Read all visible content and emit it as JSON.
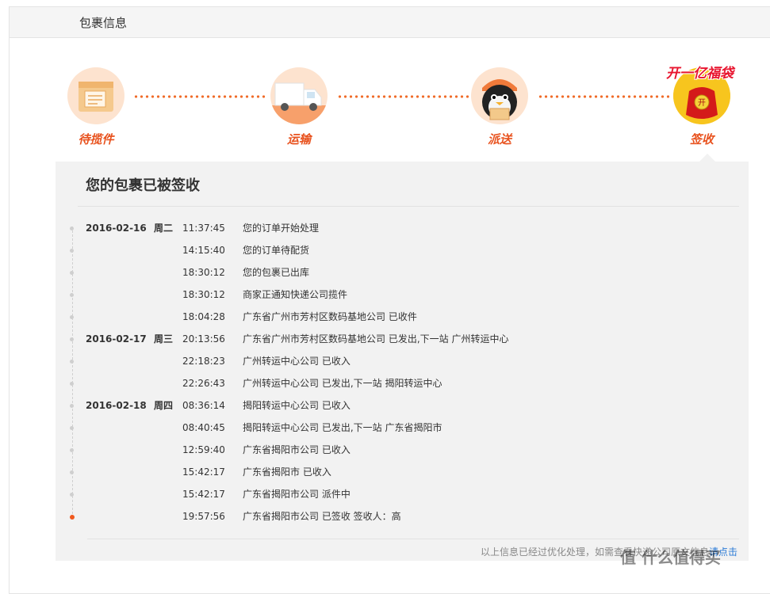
{
  "header": {
    "title": "包裹信息"
  },
  "steps": [
    {
      "label": "待揽件",
      "icon": "package-waiting-icon"
    },
    {
      "label": "运输",
      "icon": "truck-icon"
    },
    {
      "label": "派送",
      "icon": "courier-penguin-icon"
    },
    {
      "label": "签收",
      "icon": "red-envelope-icon"
    }
  ],
  "promo": {
    "text": "开一亿福袋",
    "badge_text": "开"
  },
  "box": {
    "title": "您的包裹已被签收",
    "rows": [
      {
        "date": "2016-02-16",
        "week": "周二",
        "time": "11:37:45",
        "desc": "您的订单开始处理"
      },
      {
        "date": "",
        "week": "",
        "time": "14:15:40",
        "desc": "您的订单待配货"
      },
      {
        "date": "",
        "week": "",
        "time": "18:30:12",
        "desc": "您的包裹已出库"
      },
      {
        "date": "",
        "week": "",
        "time": "18:30:12",
        "desc": "商家正通知快递公司揽件"
      },
      {
        "date": "",
        "week": "",
        "time": "18:04:28",
        "desc": "广东省广州市芳村区数码基地公司 已收件"
      },
      {
        "date": "2016-02-17",
        "week": "周三",
        "time": "20:13:56",
        "desc": "广东省广州市芳村区数码基地公司 已发出,下一站 广州转运中心"
      },
      {
        "date": "",
        "week": "",
        "time": "22:18:23",
        "desc": "广州转运中心公司 已收入"
      },
      {
        "date": "",
        "week": "",
        "time": "22:26:43",
        "desc": "广州转运中心公司 已发出,下一站 揭阳转运中心"
      },
      {
        "date": "2016-02-18",
        "week": "周四",
        "time": "08:36:14",
        "desc": "揭阳转运中心公司 已收入"
      },
      {
        "date": "",
        "week": "",
        "time": "08:40:45",
        "desc": "揭阳转运中心公司 已发出,下一站 广东省揭阳市"
      },
      {
        "date": "",
        "week": "",
        "time": "12:59:40",
        "desc": "广东省揭阳市公司 已收入"
      },
      {
        "date": "",
        "week": "",
        "time": "15:42:17",
        "desc": "广东省揭阳市 已收入"
      },
      {
        "date": "",
        "week": "",
        "time": "15:42:17",
        "desc": "广东省揭阳市公司 派件中"
      },
      {
        "date": "",
        "week": "",
        "time": "19:57:56",
        "desc": "广东省揭阳市公司 已签收 签收人：高"
      }
    ],
    "footer_note": "以上信息已经过优化处理，如需查看快递公司原文信息",
    "footer_link": "请点击"
  },
  "watermark": "值 什么值得买",
  "colors": {
    "accent": "#e8521e",
    "dots": "#f06d2b",
    "panel": "#f2f2f2",
    "promo_red": "#e8142e"
  }
}
